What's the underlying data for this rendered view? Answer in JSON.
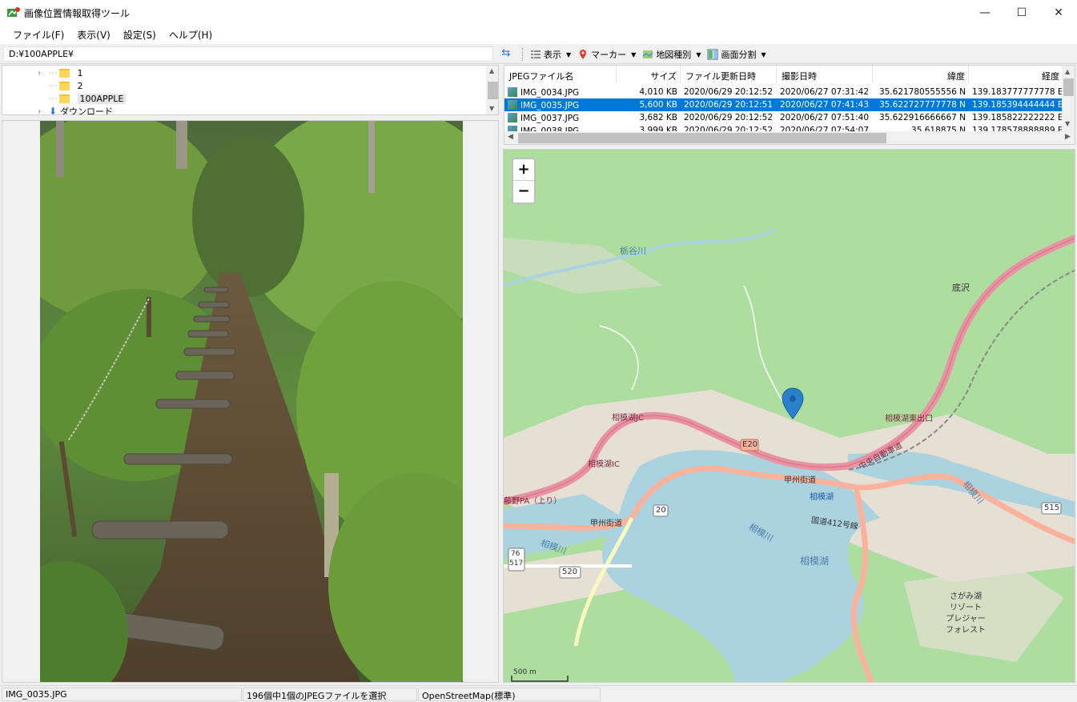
{
  "window": {
    "title": "画像位置情報取得ツール",
    "minimize": "—",
    "maximize": "☐",
    "close": "✕"
  },
  "menu": [
    "ファイル(F)",
    "表示(V)",
    "設定(S)",
    "ヘルプ(H)"
  ],
  "path": "D:¥100APPLE¥",
  "toolbar": {
    "view": "表示",
    "marker": "マーカー",
    "map_type": "地図種別",
    "split": "画面分割"
  },
  "tree": {
    "items": [
      "1",
      "2",
      "100APPLE",
      "ダウンロード"
    ]
  },
  "filelist": {
    "columns": [
      "JPEGファイル名",
      "サイズ",
      "ファイル更新日時",
      "撮影日時",
      "緯度",
      "経度"
    ],
    "rows": [
      {
        "name": "IMG_0034.JPG",
        "size": "4,010 KB",
        "modified": "2020/06/29 20:12:52",
        "taken": "2020/06/27 07:31:42",
        "lat": "35.621780555556 N",
        "lon": "139.183777777778 E"
      },
      {
        "name": "IMG_0035.JPG",
        "size": "5,600 KB",
        "modified": "2020/06/29 20:12:51",
        "taken": "2020/06/27 07:41:43",
        "lat": "35.622727777778 N",
        "lon": "139.185394444444 E"
      },
      {
        "name": "IMG_0037.JPG",
        "size": "3,682 KB",
        "modified": "2020/06/29 20:12:52",
        "taken": "2020/06/27 07:51:40",
        "lat": "35.622916666667 N",
        "lon": "139.185822222222 E"
      },
      {
        "name": "IMG_0038.JPG",
        "size": "3,999 KB",
        "modified": "2020/06/29 20:12:52",
        "taken": "2020/06/27 07:54:07",
        "lat": "35.618875 N",
        "lon": "139.178578888889 E"
      }
    ],
    "selected_index": 1
  },
  "map": {
    "zoom_in": "+",
    "zoom_out": "−",
    "labels": {
      "tochiya": "栃谷川",
      "sokozawa": "底沢",
      "sagamiko_jct": "相模湖JC",
      "sagamiko_ic": "相模湖IC",
      "sagamiko_higashi": "相模湖東出口",
      "e20": "E20",
      "chuo": "中央自動車道",
      "koshu1": "甲州街道",
      "koshu2": "甲州街道",
      "sagamiko_town": "相模湖",
      "lake": "相模湖",
      "river1": "相模川",
      "river2": "相模川",
      "river3": "相模川",
      "fujino": "藤野PA（上り）",
      "route412": "国道412号線",
      "r20": "20",
      "r76": "76",
      "r517": "517",
      "r520": "520",
      "r515": "515",
      "resort": "さがみ湖\nリゾート\nプレジャー\nフォレスト",
      "scale": "500 m"
    }
  },
  "status": {
    "file": "IMG_0035.JPG",
    "selection": "196個中1個のJPEGファイルを選択",
    "provider": "OpenStreetMap(標準)"
  },
  "colors": {
    "selection": "#0078d7",
    "map_bg": "#addd9f",
    "water": "#aad3df",
    "motorway": "#e892a2",
    "trunk": "#f9b29c",
    "marker": "#2a81cb"
  }
}
